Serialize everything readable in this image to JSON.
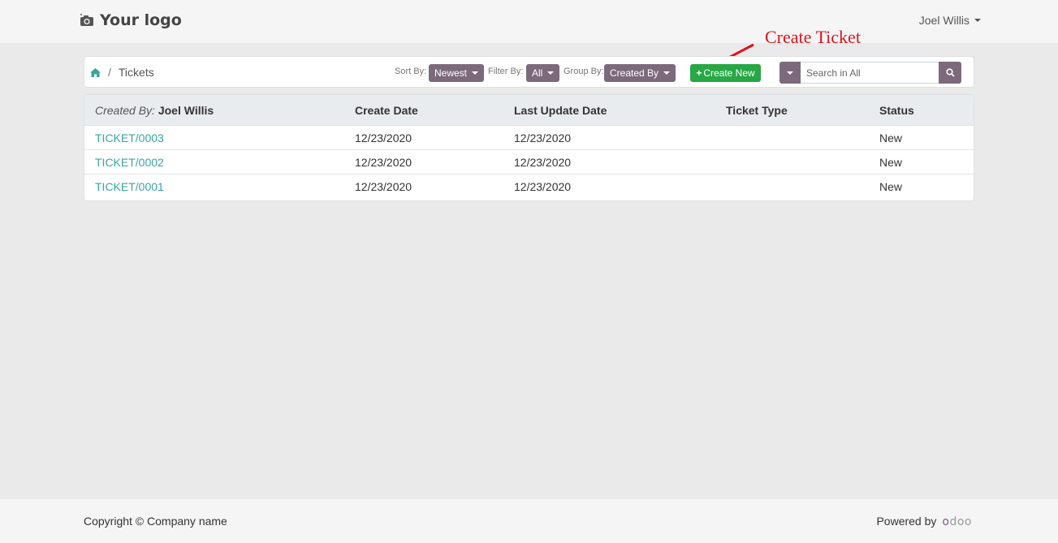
{
  "header": {
    "logo_text": "Your logo",
    "user_name": "Joel Willis"
  },
  "annotation": {
    "text": "Create Ticket",
    "color": "#e0131d"
  },
  "breadcrumb": {
    "home_icon": "home-icon",
    "separator": "/",
    "current": "Tickets"
  },
  "toolbar": {
    "sort_label": "Sort By:",
    "sort_value": "Newest",
    "filter_label": "Filter By:",
    "filter_value": "All",
    "group_label": "Group By:",
    "group_value": "Created By",
    "create_label": "Create New",
    "search_placeholder": "Search in All",
    "search_icon": "search-icon",
    "accent_color": "#7c6a7c",
    "create_color": "#28a745"
  },
  "table": {
    "group_prefix": "Created By:",
    "group_value": "Joel Willis",
    "columns": [
      "Create Date",
      "Last Update Date",
      "Ticket Type",
      "Status"
    ],
    "rows": [
      {
        "ticket": "TICKET/0003",
        "create_date": "12/23/2020",
        "update_date": "12/23/2020",
        "type": "",
        "status": "New"
      },
      {
        "ticket": "TICKET/0002",
        "create_date": "12/23/2020",
        "update_date": "12/23/2020",
        "type": "",
        "status": "New"
      },
      {
        "ticket": "TICKET/0001",
        "create_date": "12/23/2020",
        "update_date": "12/23/2020",
        "type": "",
        "status": "New"
      }
    ],
    "link_color": "#3aa5a0"
  },
  "footer": {
    "copyright": "Copyright © Company name",
    "powered_by": "Powered by",
    "odoo_o1": "o",
    "odoo_rest": "doo"
  }
}
